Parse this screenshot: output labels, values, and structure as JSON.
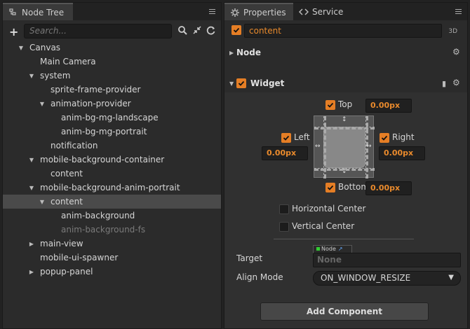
{
  "left_panel": {
    "tab_label": "Node Tree",
    "search_placeholder": "Search...",
    "tree": [
      {
        "label": "Canvas",
        "arrow": "expanded",
        "depth": 0
      },
      {
        "label": "Main Camera",
        "arrow": "none",
        "depth": 1
      },
      {
        "label": "system",
        "arrow": "expanded",
        "depth": 1
      },
      {
        "label": "sprite-frame-provider",
        "arrow": "none",
        "depth": 2
      },
      {
        "label": "animation-provider",
        "arrow": "expanded",
        "depth": 2
      },
      {
        "label": "anim-bg-mg-landscape",
        "arrow": "none",
        "depth": 3
      },
      {
        "label": "anim-bg-mg-portrait",
        "arrow": "none",
        "depth": 3
      },
      {
        "label": "notification",
        "arrow": "none",
        "depth": 2
      },
      {
        "label": "mobile-background-container",
        "arrow": "expanded",
        "depth": 1
      },
      {
        "label": "content",
        "arrow": "none",
        "depth": 2
      },
      {
        "label": "mobile-background-anim-portrait",
        "arrow": "expanded",
        "depth": 1
      },
      {
        "label": "content",
        "arrow": "expanded",
        "depth": 2,
        "selected": true
      },
      {
        "label": "anim-background",
        "arrow": "none",
        "depth": 3
      },
      {
        "label": "anim-background-fs",
        "arrow": "none",
        "depth": 3,
        "dim": true
      },
      {
        "label": "main-view",
        "arrow": "collapsed",
        "depth": 1
      },
      {
        "label": "mobile-ui-spawner",
        "arrow": "none",
        "depth": 1
      },
      {
        "label": "popup-panel",
        "arrow": "collapsed",
        "depth": 1
      }
    ]
  },
  "right_panel": {
    "tabs": [
      {
        "label": "Properties"
      },
      {
        "label": "Service"
      }
    ],
    "node_name": "content",
    "mode_label": "3D",
    "node_section_label": "Node",
    "widget_section_label": "Widget",
    "top": {
      "label": "Top",
      "value": "0.00px",
      "checked": true
    },
    "left": {
      "label": "Left",
      "value": "0.00px",
      "checked": true
    },
    "right": {
      "label": "Right",
      "value": "0.00px",
      "checked": true
    },
    "bottom": {
      "label": "Bottom",
      "value": "0.00px",
      "checked": true
    },
    "horizontal_center": {
      "label": "Horizontal Center",
      "checked": false
    },
    "vertical_center": {
      "label": "Vertical Center",
      "checked": false
    },
    "target": {
      "label": "Target",
      "tag": "Node",
      "value": "None"
    },
    "align_mode": {
      "label": "Align Mode",
      "value": "ON_WINDOW_RESIZE"
    },
    "add_component_label": "Add Component"
  },
  "colors": {
    "accent": "#e57e25",
    "panel_bg": "#2b2b2b",
    "selected_row": "#4a4a4a"
  }
}
